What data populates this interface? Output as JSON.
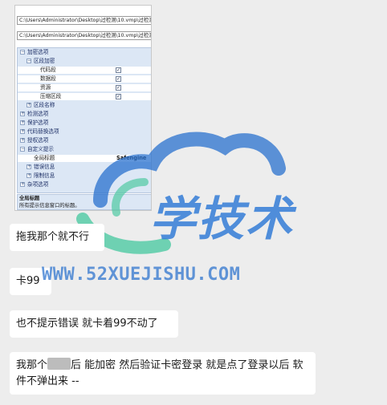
{
  "screenshot": {
    "path1": "C:\\Users\\Administrator\\Desktop\\过检测\\10.vmp\\过检测\\10.vm",
    "path2": "C:\\Users\\Administrator\\Desktop\\过检测\\10.vmp\\过检测\\10.vm",
    "tree": [
      {
        "label": "加密选项",
        "level": 0,
        "expander": "−",
        "kind": "cat"
      },
      {
        "label": "区段加密",
        "level": 1,
        "expander": "−",
        "kind": "cat"
      },
      {
        "label": "代码段",
        "level": 2,
        "checked": true,
        "kind": "item"
      },
      {
        "label": "数据段",
        "level": 2,
        "checked": true,
        "kind": "item"
      },
      {
        "label": "资源",
        "level": 2,
        "checked": true,
        "kind": "item"
      },
      {
        "label": "压缩区段",
        "level": 2,
        "checked": true,
        "kind": "item"
      },
      {
        "label": "区段名称",
        "level": 1,
        "expander": "+",
        "kind": "cat"
      },
      {
        "label": "检测选项",
        "level": 0,
        "expander": "+",
        "kind": "cat"
      },
      {
        "label": "保护选项",
        "level": 0,
        "expander": "+",
        "kind": "cat"
      },
      {
        "label": "代码替换选项",
        "level": 0,
        "expander": "+",
        "kind": "cat"
      },
      {
        "label": "授权选项",
        "level": 0,
        "expander": "+",
        "kind": "cat"
      },
      {
        "label": "自定义提示",
        "level": 0,
        "expander": "−",
        "kind": "cat"
      },
      {
        "label": "全局标题",
        "level": 1,
        "value": "Safengine",
        "kind": "value"
      },
      {
        "label": "错误信息",
        "level": 1,
        "expander": "+",
        "kind": "cat"
      },
      {
        "label": "限制信息",
        "level": 1,
        "expander": "+",
        "kind": "cat"
      },
      {
        "label": "杂项选项",
        "level": 0,
        "expander": "+",
        "kind": "cat"
      }
    ],
    "description_title": "全局标题",
    "description_text": "所有提示信息窗口的标题。"
  },
  "messages": {
    "m1": "拖我那个就不行",
    "m2": "卡99",
    "m3": "也不提示错误 就卡着99不动了",
    "m4_a": "我那个",
    "m4_b": "后  能加密  然后验证卡密登录  就是点了登录以后 软件不弹出来 --"
  },
  "watermark": {
    "logo_text": "学技术",
    "url": "WWW.52XUEJISHU.COM",
    "colors": {
      "blue": "#2c78d6",
      "green": "#4ec9a2"
    }
  }
}
